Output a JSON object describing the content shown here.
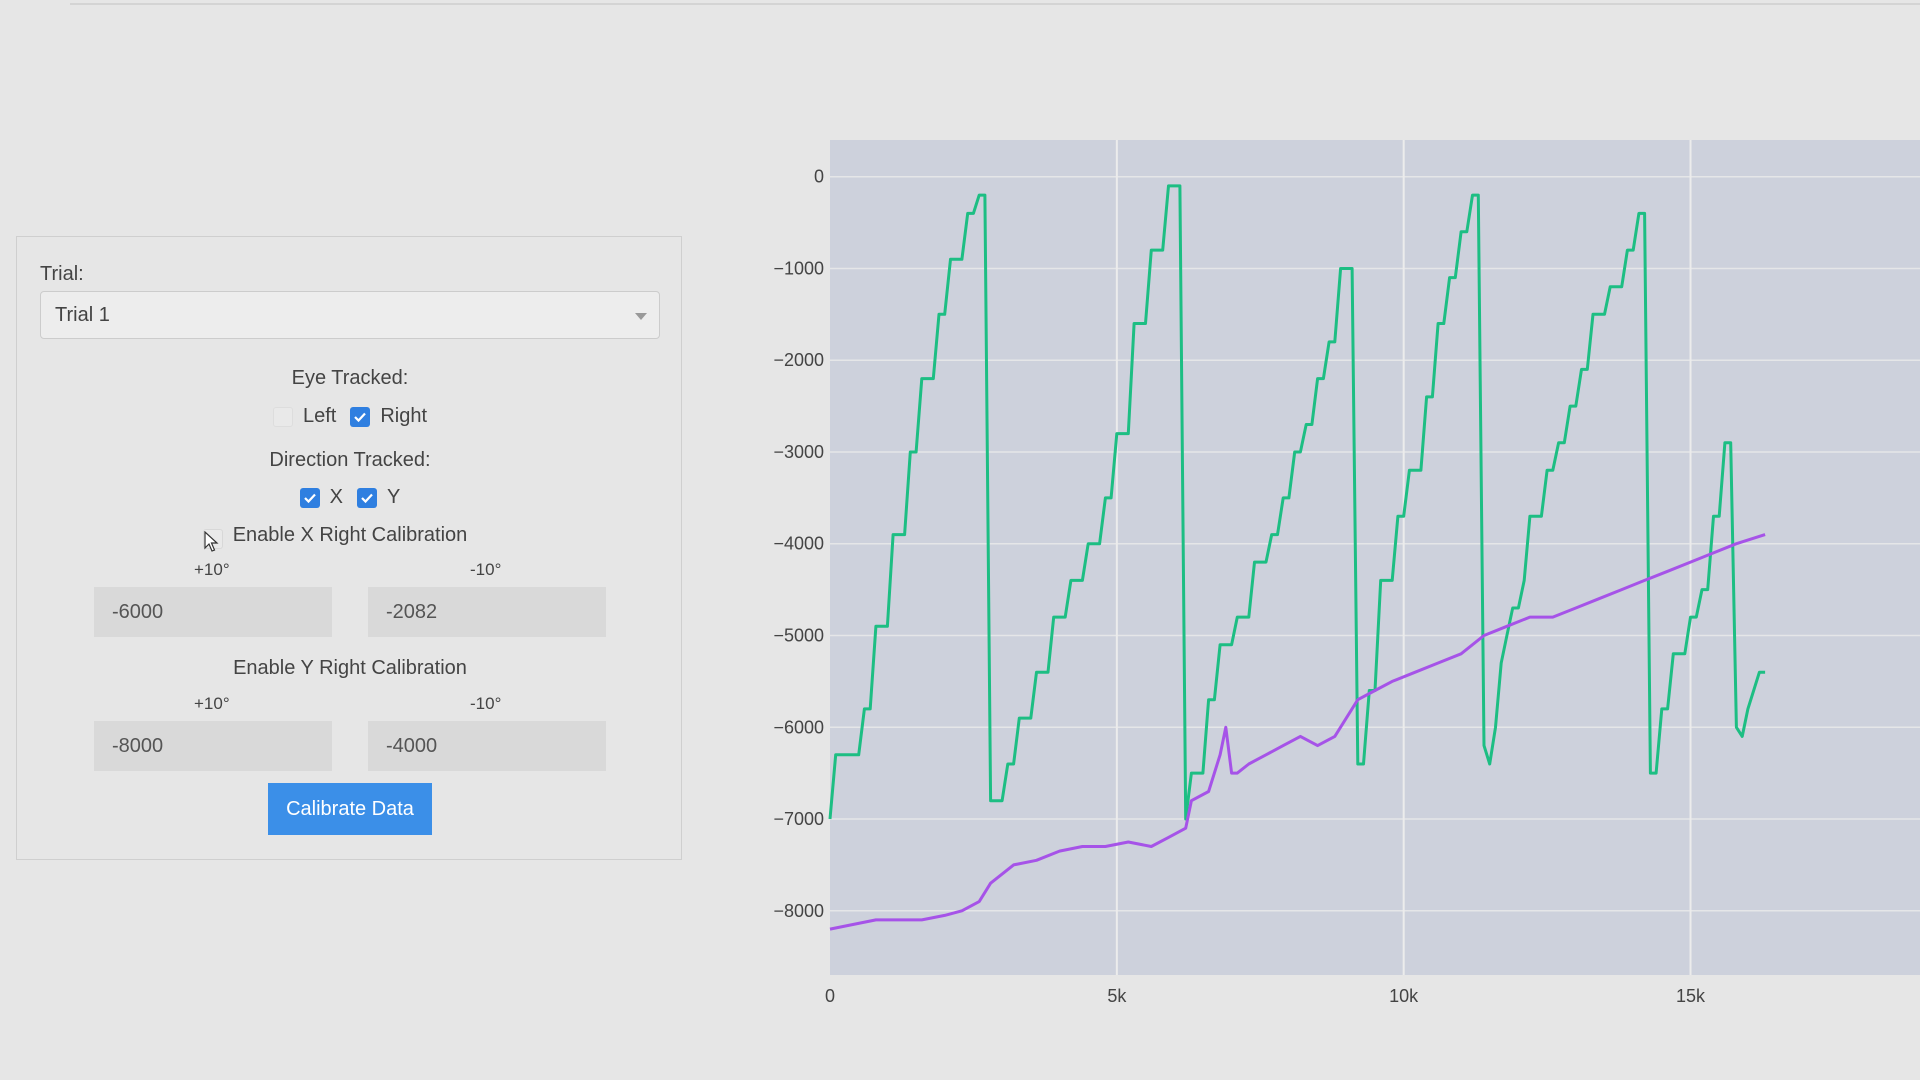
{
  "panel": {
    "trial_label": "Trial:",
    "trial_selected": "Trial 1",
    "eye_tracked_label": "Eye Tracked:",
    "eye_options": [
      {
        "label": "Left",
        "checked": false
      },
      {
        "label": "Right",
        "checked": true
      }
    ],
    "direction_label": "Direction Tracked:",
    "direction_options": [
      {
        "label": "X",
        "checked": true
      },
      {
        "label": "Y",
        "checked": true
      }
    ],
    "x_calibration": {
      "label": "Enable X Right Calibration",
      "enabled": false,
      "plus_label": "+10°",
      "minus_label": "-10°",
      "plus_value": "-6000",
      "minus_value": "-2082"
    },
    "y_calibration": {
      "label": "Enable Y Right Calibration",
      "plus_label": "+10°",
      "minus_label": "-10°",
      "plus_value": "-8000",
      "minus_value": "-4000"
    },
    "calibrate_button": "Calibrate Data"
  },
  "chart_data": {
    "type": "line",
    "title": "",
    "xlabel": "",
    "ylabel": "",
    "xlim": [
      0,
      19000
    ],
    "ylim": [
      -8700,
      400
    ],
    "x_ticks": [
      0,
      5000,
      10000,
      15000
    ],
    "x_tick_labels": [
      "0",
      "5k",
      "10k",
      "15k"
    ],
    "y_ticks": [
      0,
      -1000,
      -2000,
      -3000,
      -4000,
      -5000,
      -6000,
      -7000,
      -8000
    ],
    "y_tick_labels": [
      "0",
      "−1000",
      "−2000",
      "−3000",
      "−4000",
      "−5000",
      "−6000",
      "−7000",
      "−8000"
    ],
    "grid": true,
    "colors": {
      "x_series": "#1dbe83",
      "y_series": "#a653e8",
      "plot_bg": "#cdd1dc",
      "grid": "#ececec"
    },
    "series": [
      {
        "name": "",
        "color": "#1dbe83",
        "points": [
          [
            0,
            -7000
          ],
          [
            100,
            -6300
          ],
          [
            500,
            -6300
          ],
          [
            600,
            -5800
          ],
          [
            700,
            -5800
          ],
          [
            800,
            -4900
          ],
          [
            1000,
            -4900
          ],
          [
            1100,
            -3900
          ],
          [
            1300,
            -3900
          ],
          [
            1400,
            -3000
          ],
          [
            1500,
            -3000
          ],
          [
            1600,
            -2200
          ],
          [
            1800,
            -2200
          ],
          [
            1900,
            -1500
          ],
          [
            2000,
            -1500
          ],
          [
            2100,
            -900
          ],
          [
            2300,
            -900
          ],
          [
            2400,
            -400
          ],
          [
            2500,
            -400
          ],
          [
            2600,
            -200
          ],
          [
            2700,
            -200
          ],
          [
            2800,
            -6800
          ],
          [
            3000,
            -6800
          ],
          [
            3100,
            -6400
          ],
          [
            3200,
            -6400
          ],
          [
            3300,
            -5900
          ],
          [
            3500,
            -5900
          ],
          [
            3600,
            -5400
          ],
          [
            3800,
            -5400
          ],
          [
            3900,
            -4800
          ],
          [
            4100,
            -4800
          ],
          [
            4200,
            -4400
          ],
          [
            4400,
            -4400
          ],
          [
            4500,
            -4000
          ],
          [
            4700,
            -4000
          ],
          [
            4800,
            -3500
          ],
          [
            4900,
            -3500
          ],
          [
            5000,
            -2800
          ],
          [
            5200,
            -2800
          ],
          [
            5300,
            -1600
          ],
          [
            5500,
            -1600
          ],
          [
            5600,
            -800
          ],
          [
            5800,
            -800
          ],
          [
            5900,
            -100
          ],
          [
            6100,
            -100
          ],
          [
            6200,
            -7000
          ],
          [
            6300,
            -6500
          ],
          [
            6500,
            -6500
          ],
          [
            6600,
            -5700
          ],
          [
            6700,
            -5700
          ],
          [
            6800,
            -5100
          ],
          [
            7000,
            -5100
          ],
          [
            7100,
            -4800
          ],
          [
            7300,
            -4800
          ],
          [
            7400,
            -4200
          ],
          [
            7600,
            -4200
          ],
          [
            7700,
            -3900
          ],
          [
            7800,
            -3900
          ],
          [
            7900,
            -3500
          ],
          [
            8000,
            -3500
          ],
          [
            8100,
            -3000
          ],
          [
            8200,
            -3000
          ],
          [
            8300,
            -2700
          ],
          [
            8400,
            -2700
          ],
          [
            8500,
            -2200
          ],
          [
            8600,
            -2200
          ],
          [
            8700,
            -1800
          ],
          [
            8800,
            -1800
          ],
          [
            8900,
            -1000
          ],
          [
            9100,
            -1000
          ],
          [
            9200,
            -6400
          ],
          [
            9300,
            -6400
          ],
          [
            9400,
            -5600
          ],
          [
            9500,
            -5600
          ],
          [
            9600,
            -4400
          ],
          [
            9800,
            -4400
          ],
          [
            9900,
            -3700
          ],
          [
            10000,
            -3700
          ],
          [
            10100,
            -3200
          ],
          [
            10300,
            -3200
          ],
          [
            10400,
            -2400
          ],
          [
            10500,
            -2400
          ],
          [
            10600,
            -1600
          ],
          [
            10700,
            -1600
          ],
          [
            10800,
            -1100
          ],
          [
            10900,
            -1100
          ],
          [
            11000,
            -600
          ],
          [
            11100,
            -600
          ],
          [
            11200,
            -200
          ],
          [
            11300,
            -200
          ],
          [
            11400,
            -6200
          ],
          [
            11500,
            -6400
          ],
          [
            11600,
            -6000
          ],
          [
            11700,
            -5300
          ],
          [
            11800,
            -5000
          ],
          [
            11900,
            -4700
          ],
          [
            12000,
            -4700
          ],
          [
            12100,
            -4400
          ],
          [
            12200,
            -3700
          ],
          [
            12400,
            -3700
          ],
          [
            12500,
            -3200
          ],
          [
            12600,
            -3200
          ],
          [
            12700,
            -2900
          ],
          [
            12800,
            -2900
          ],
          [
            12900,
            -2500
          ],
          [
            13000,
            -2500
          ],
          [
            13100,
            -2100
          ],
          [
            13200,
            -2100
          ],
          [
            13300,
            -1500
          ],
          [
            13500,
            -1500
          ],
          [
            13600,
            -1200
          ],
          [
            13800,
            -1200
          ],
          [
            13900,
            -800
          ],
          [
            14000,
            -800
          ],
          [
            14100,
            -400
          ],
          [
            14200,
            -400
          ],
          [
            14300,
            -6500
          ],
          [
            14400,
            -6500
          ],
          [
            14500,
            -5800
          ],
          [
            14600,
            -5800
          ],
          [
            14700,
            -5200
          ],
          [
            14900,
            -5200
          ],
          [
            15000,
            -4800
          ],
          [
            15100,
            -4800
          ],
          [
            15200,
            -4500
          ],
          [
            15300,
            -4500
          ],
          [
            15400,
            -3700
          ],
          [
            15500,
            -3700
          ],
          [
            15600,
            -2900
          ],
          [
            15700,
            -2900
          ],
          [
            15800,
            -6000
          ],
          [
            15900,
            -6100
          ],
          [
            16000,
            -5800
          ],
          [
            16200,
            -5400
          ],
          [
            16300,
            -5400
          ]
        ]
      },
      {
        "name": "",
        "color": "#a653e8",
        "points": [
          [
            0,
            -8200
          ],
          [
            400,
            -8150
          ],
          [
            800,
            -8100
          ],
          [
            1200,
            -8100
          ],
          [
            1600,
            -8100
          ],
          [
            2000,
            -8050
          ],
          [
            2300,
            -8000
          ],
          [
            2600,
            -7900
          ],
          [
            2800,
            -7700
          ],
          [
            3200,
            -7500
          ],
          [
            3600,
            -7450
          ],
          [
            4000,
            -7350
          ],
          [
            4400,
            -7300
          ],
          [
            4800,
            -7300
          ],
          [
            5200,
            -7250
          ],
          [
            5600,
            -7300
          ],
          [
            5900,
            -7200
          ],
          [
            6200,
            -7100
          ],
          [
            6300,
            -6800
          ],
          [
            6600,
            -6700
          ],
          [
            6800,
            -6300
          ],
          [
            6900,
            -6000
          ],
          [
            7000,
            -6500
          ],
          [
            7100,
            -6500
          ],
          [
            7300,
            -6400
          ],
          [
            7600,
            -6300
          ],
          [
            7900,
            -6200
          ],
          [
            8200,
            -6100
          ],
          [
            8500,
            -6200
          ],
          [
            8800,
            -6100
          ],
          [
            9000,
            -5900
          ],
          [
            9200,
            -5700
          ],
          [
            9500,
            -5600
          ],
          [
            9800,
            -5500
          ],
          [
            10200,
            -5400
          ],
          [
            10600,
            -5300
          ],
          [
            11000,
            -5200
          ],
          [
            11400,
            -5000
          ],
          [
            11800,
            -4900
          ],
          [
            12200,
            -4800
          ],
          [
            12600,
            -4800
          ],
          [
            13000,
            -4700
          ],
          [
            13400,
            -4600
          ],
          [
            13800,
            -4500
          ],
          [
            14200,
            -4400
          ],
          [
            14600,
            -4300
          ],
          [
            15000,
            -4200
          ],
          [
            15400,
            -4100
          ],
          [
            15800,
            -4000
          ],
          [
            16300,
            -3900
          ]
        ]
      }
    ]
  }
}
